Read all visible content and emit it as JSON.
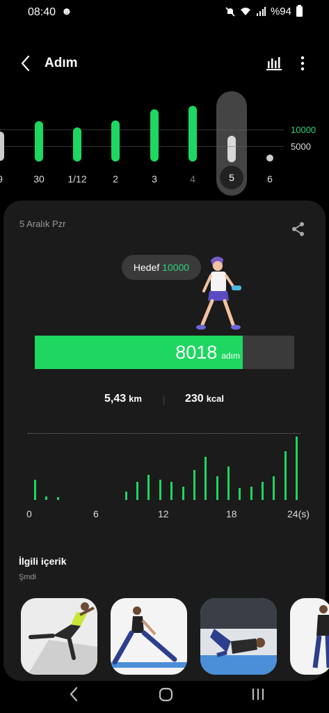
{
  "status_bar": {
    "time": "08:40",
    "battery": "%94",
    "icons": [
      "person-icon",
      "mute-icon",
      "wifi-icon",
      "signal-icon",
      "battery-icon"
    ]
  },
  "header": {
    "title": "Adım",
    "icons": [
      "back-icon",
      "bar-chart-icon",
      "more-icon"
    ]
  },
  "weekly_chart": {
    "goal_labels": [
      "10000",
      "5000"
    ],
    "day_labels": [
      "9",
      "30",
      "1/12",
      "2",
      "3",
      "4",
      "5",
      "6"
    ],
    "selected_day": "5"
  },
  "day_summary": {
    "date": "5 Aralık Pzr",
    "goal_label": "Hedef",
    "goal_value": "10000",
    "steps": "8018",
    "steps_unit": "adım",
    "progress_fraction": 0.8018,
    "distance": "5,43",
    "distance_unit": "km",
    "calories": "230",
    "calories_unit": "kcal"
  },
  "chart_data": {
    "type": "bar",
    "categories": [
      "0",
      "1",
      "2",
      "3",
      "4",
      "5",
      "6",
      "7",
      "8",
      "9",
      "10",
      "11",
      "12",
      "13",
      "14",
      "15",
      "16",
      "17",
      "18",
      "19",
      "20",
      "21",
      "22",
      "23"
    ],
    "x_tick_labels": [
      "0",
      "6",
      "12",
      "18",
      "24(s)"
    ],
    "series": [
      {
        "values": [
          120,
          20,
          15,
          0,
          0,
          0,
          0,
          0,
          50,
          110,
          150,
          120,
          110,
          80,
          180,
          260,
          140,
          200,
          70,
          80,
          110,
          140,
          290,
          380
        ]
      }
    ],
    "color": "#1ed760"
  },
  "related": {
    "title": "İlgili içerik",
    "subtitle": "Şmdi"
  },
  "colors": {
    "accent": "#1ed760",
    "card_background": "#1b1b1b",
    "background": "#000000"
  }
}
